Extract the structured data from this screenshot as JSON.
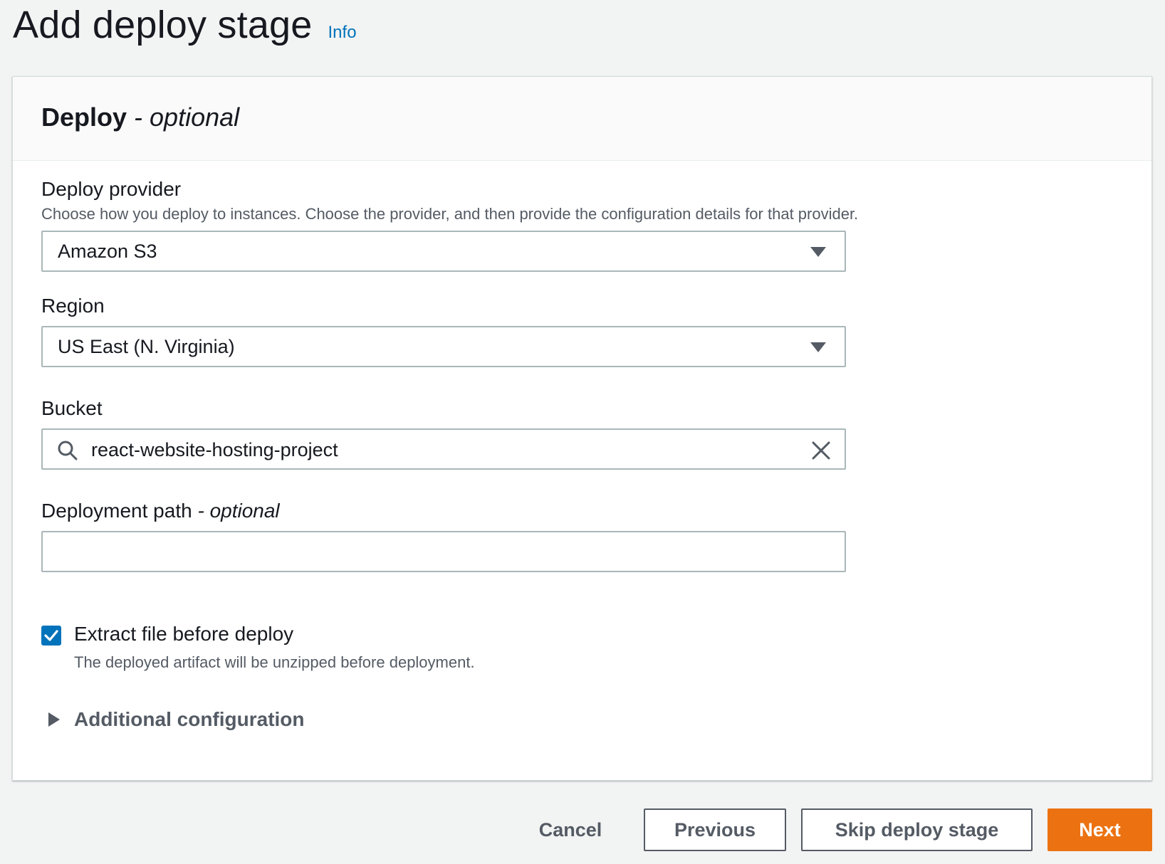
{
  "header": {
    "title": "Add deploy stage",
    "info_link": "Info"
  },
  "panel": {
    "title": "Deploy",
    "title_optional": " - optional"
  },
  "deploy_provider": {
    "label": "Deploy provider",
    "description": "Choose how you deploy to instances. Choose the provider, and then provide the configuration details for that provider.",
    "selected": "Amazon S3"
  },
  "region": {
    "label": "Region",
    "selected": "US East (N. Virginia)"
  },
  "bucket": {
    "label": "Bucket",
    "value": "react-website-hosting-project"
  },
  "deployment_path": {
    "label": "Deployment path",
    "label_optional": " - optional",
    "value": ""
  },
  "extract": {
    "label": "Extract file before deploy",
    "description": "The deployed artifact will be unzipped before deployment.",
    "checked": true
  },
  "additional_config": {
    "label": "Additional configuration"
  },
  "actions": {
    "cancel": "Cancel",
    "previous": "Previous",
    "skip": "Skip deploy stage",
    "next": "Next"
  },
  "colors": {
    "primary": "#ec7211",
    "link": "#0073bb",
    "checkbox": "#0073bb"
  }
}
